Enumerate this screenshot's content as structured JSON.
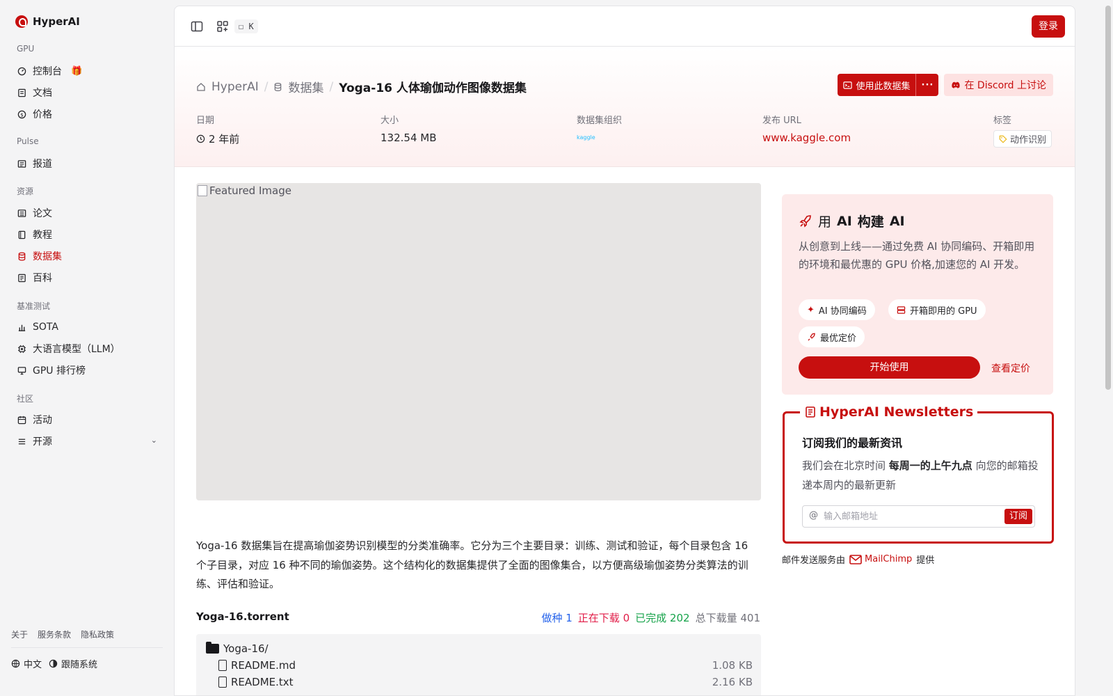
{
  "app": {
    "name": "HyperAI"
  },
  "sidebar": {
    "sections": [
      {
        "title": "GPU",
        "items": [
          {
            "label": "控制台",
            "icon": "gauge-icon"
          },
          {
            "label": "文档",
            "icon": "doc-icon"
          },
          {
            "label": "价格",
            "icon": "dollar-icon"
          }
        ]
      },
      {
        "title": "Pulse",
        "items": [
          {
            "label": "报道",
            "icon": "news-icon"
          }
        ]
      },
      {
        "title": "资源",
        "items": [
          {
            "label": "论文",
            "icon": "paper-icon"
          },
          {
            "label": "教程",
            "icon": "book-icon"
          },
          {
            "label": "数据集",
            "icon": "database-icon",
            "active": true
          },
          {
            "label": "百科",
            "icon": "wiki-icon"
          }
        ]
      },
      {
        "title": "基准测试",
        "items": [
          {
            "label": "SOTA",
            "icon": "chart-icon"
          },
          {
            "label": "大语言模型（LLM）",
            "icon": "chip-icon"
          },
          {
            "label": "GPU 排行榜",
            "icon": "monitor-icon"
          }
        ]
      },
      {
        "title": "社区",
        "items": [
          {
            "label": "活动",
            "icon": "calendar-icon"
          },
          {
            "label": "开源",
            "icon": "list-icon"
          }
        ]
      }
    ],
    "footer_links": [
      "关于",
      "服务条款",
      "隐私政策"
    ],
    "language": "中文",
    "theme": "跟随系统"
  },
  "topbar": {
    "shortcut": "K",
    "login": "登录"
  },
  "dataset": {
    "breadcrumb": [
      "HyperAI",
      "数据集",
      "Yoga-16 人体瑜伽动作图像数据集"
    ],
    "use_button": "使用此数据集",
    "discord_button": "在 Discord 上讨论",
    "meta": {
      "date_label": "日期",
      "date": "2 年前",
      "size_label": "大小",
      "size": "132.54 MB",
      "org_label": "数据集组织",
      "org": "kaggle",
      "url_label": "发布 URL",
      "url": "www.kaggle.com",
      "tag_label": "标签",
      "tag": "动作识别"
    },
    "featured_alt": "Featured Image",
    "description": "Yoga-16 数据集旨在提高瑜伽姿势识别模型的分类准确率。它分为三个主要目录：训练、测试和验证，每个目录包含 16 个子目录，对应 16 种不同的瑜伽姿势。这个结构化的数据集提供了全面的图像集合，以方便高级瑜伽姿势分类算法的训练、评估和验证。",
    "torrent": {
      "name": "Yoga-16.torrent",
      "seed_label": "做种",
      "seed": "1",
      "downloading_label": "正在下载",
      "downloading": "0",
      "done_label": "已完成",
      "done": "202",
      "total_label": "总下载量",
      "total": "401"
    },
    "files": {
      "folder": "Yoga-16/",
      "items": [
        {
          "name": "README.md",
          "size": "1.08 KB"
        },
        {
          "name": "README.txt",
          "size": "2.16 KB"
        }
      ]
    }
  },
  "promo": {
    "title_pre": "用",
    "title_ai1": "AI",
    "title_mid": "构建",
    "title_ai2": "AI",
    "description": "从创意到上线——通过免费 AI 协同编码、开箱即用的环境和最优惠的 GPU 价格,加速您的 AI 开发。",
    "chips": [
      "AI 协同编码",
      "开箱即用的 GPU",
      "最优定价"
    ],
    "start": "开始使用",
    "pricing": "查看定价"
  },
  "newsletter": {
    "title": "HyperAI Newsletters",
    "subtitle": "订阅我们的最新资讯",
    "desc_pre": "我们会在北京时间",
    "desc_bold": "每周一的上午九点",
    "desc_post": "向您的邮箱投递本周内的最新更新",
    "placeholder": "输入邮箱地址",
    "subscribe": "订阅",
    "provider_pre": "邮件发送服务由",
    "provider": "MailChimp",
    "provider_post": "提供"
  },
  "colors": {
    "accent": "#c70f0f",
    "seed": "#2563eb",
    "downloading": "#e11d48",
    "done": "#16a34a"
  }
}
